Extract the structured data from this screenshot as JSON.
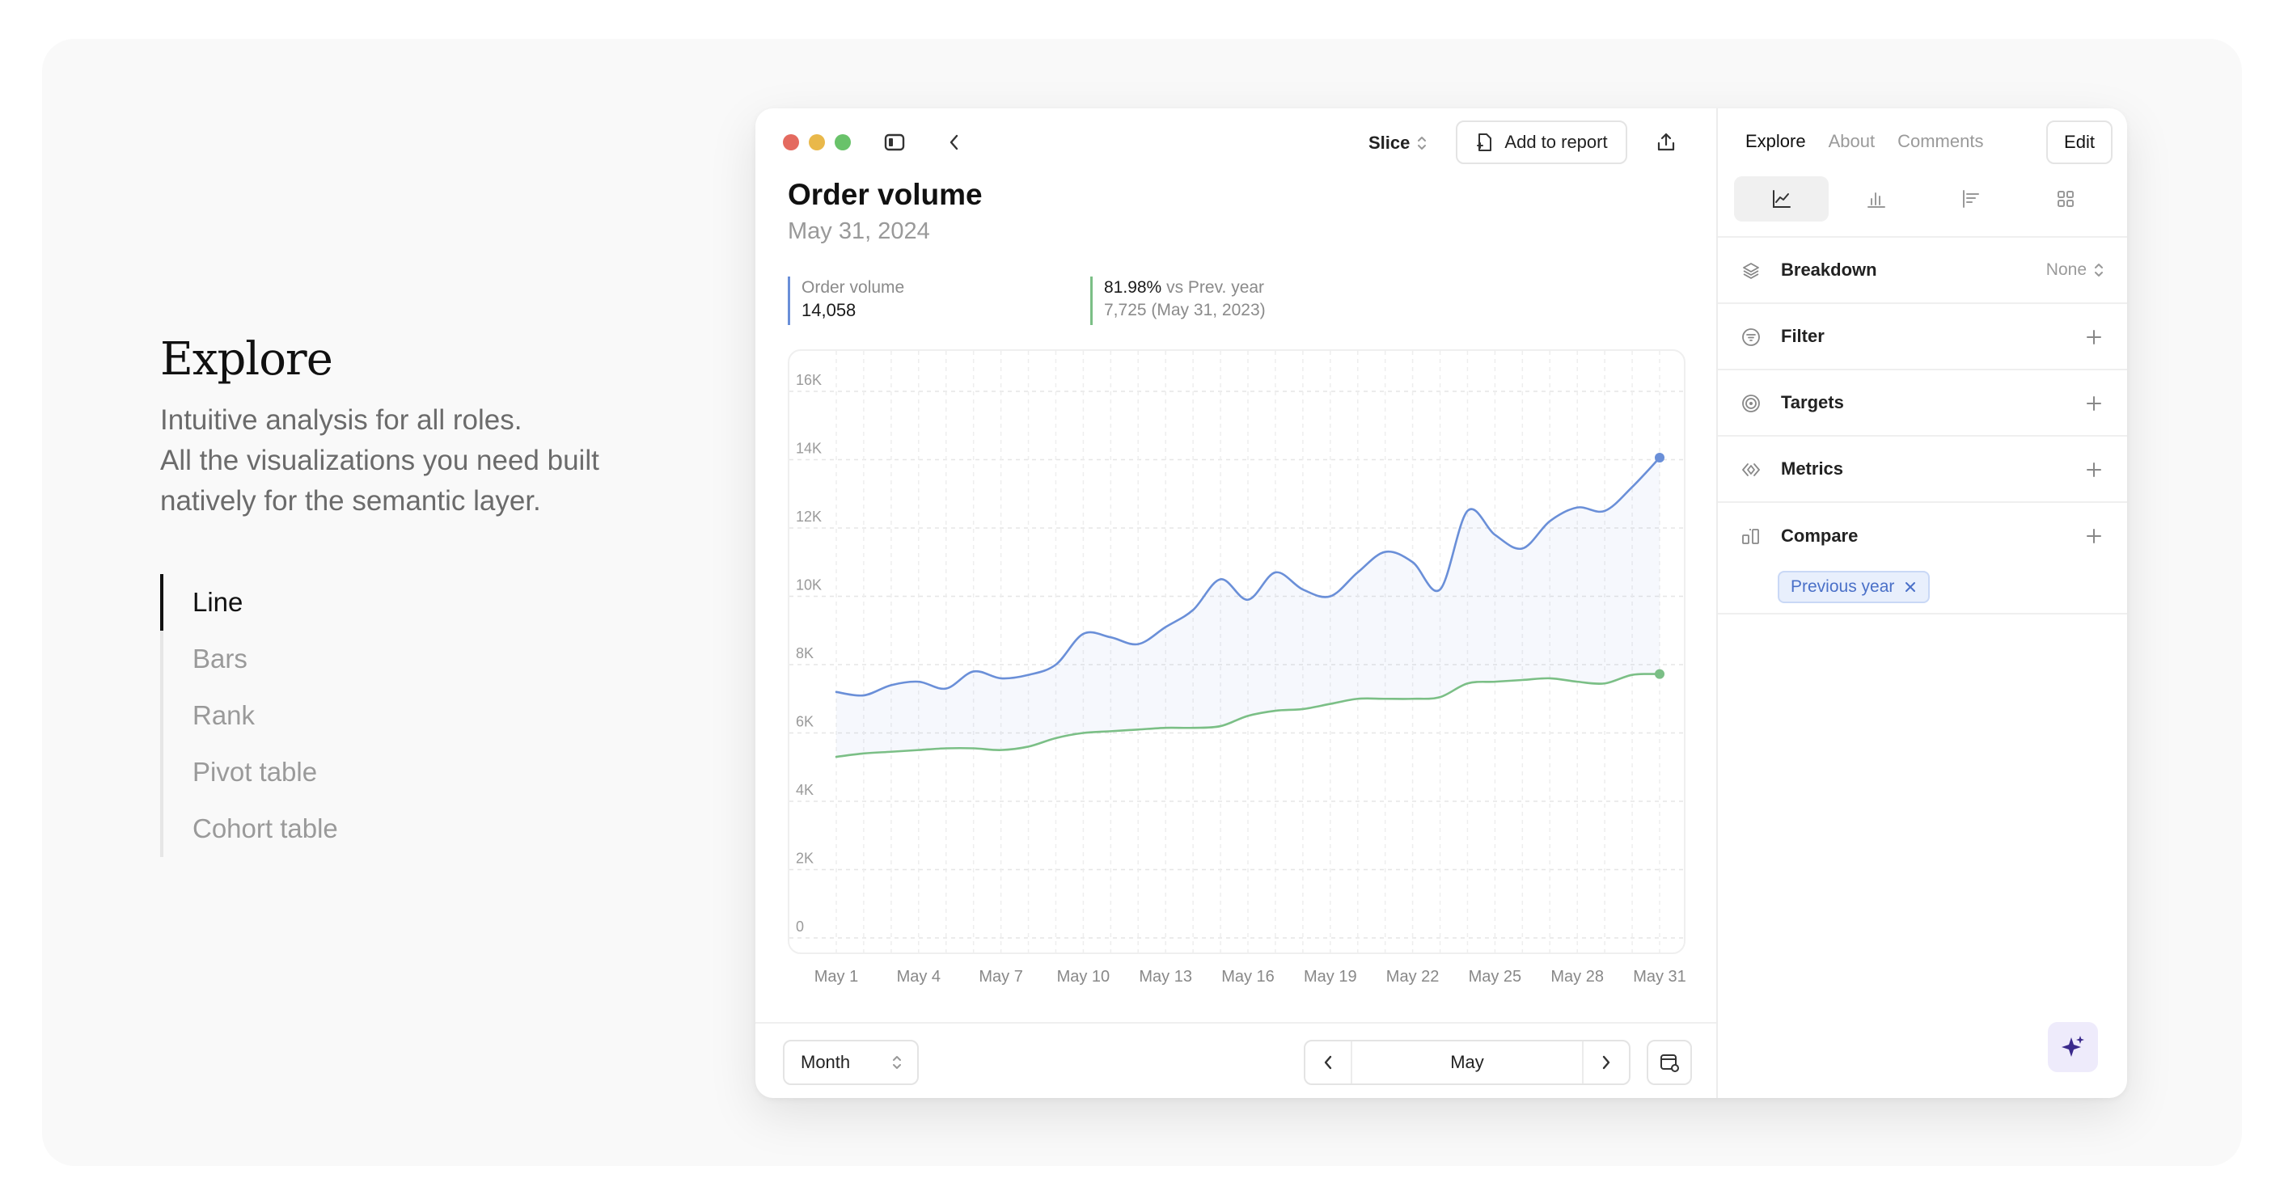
{
  "hero": {
    "title": "Explore",
    "line1": "Intuitive analysis for all roles.",
    "line2": "All the visualizations you need built",
    "line3": "natively for the semantic layer."
  },
  "modes": [
    "Line",
    "Bars",
    "Rank",
    "Pivot table",
    "Cohort table"
  ],
  "active_mode": "Line",
  "toolbar": {
    "slice_label": "Slice",
    "add_report_label": "Add to report"
  },
  "report": {
    "title": "Order volume",
    "date": "May 31, 2024"
  },
  "stats": {
    "metric_label": "Order volume",
    "metric_value": "14,058",
    "change_pct": "81.98%",
    "change_label": "vs Prev. year",
    "prev_value": "7,725 (May 31, 2023)"
  },
  "colors": {
    "current_series": "#6a8fd8",
    "previous_series": "#7bbf86",
    "window_red": "#e46a5f",
    "window_yellow": "#e9b84a",
    "window_green": "#69c26a",
    "accent_chip": "#4a70c8",
    "sparkle": "#3b2a8c"
  },
  "chart_data": {
    "type": "line",
    "x_tick_labels": [
      "May 1",
      "May 4",
      "May 7",
      "May 10",
      "May 13",
      "May 16",
      "May 19",
      "May 22",
      "May 25",
      "May 28",
      "May 31"
    ],
    "y_tick_labels": [
      "0",
      "2K",
      "4K",
      "6K",
      "8K",
      "10K",
      "12K",
      "14K",
      "16K"
    ],
    "ylim": [
      0,
      16000
    ],
    "xlim": [
      1,
      31
    ],
    "grid": true,
    "series": [
      {
        "x": [
          1,
          2,
          3,
          4,
          5,
          6,
          7,
          8,
          9,
          10,
          11,
          12,
          13,
          14,
          15,
          16,
          17,
          18,
          19,
          20,
          21,
          22,
          23,
          24,
          25,
          26,
          27,
          28,
          29,
          30,
          31
        ],
        "values": [
          7200,
          7100,
          7400,
          7500,
          7300,
          7800,
          7600,
          7700,
          8000,
          8900,
          8800,
          8600,
          9100,
          9600,
          10500,
          9900,
          10700,
          10200,
          10000,
          10700,
          11300,
          11000,
          10200,
          12500,
          11800,
          11400,
          12200,
          12600,
          12500,
          13200,
          14058
        ]
      },
      {
        "x": [
          1,
          2,
          3,
          4,
          5,
          6,
          7,
          8,
          9,
          10,
          11,
          12,
          13,
          14,
          15,
          16,
          17,
          18,
          19,
          20,
          21,
          22,
          23,
          24,
          25,
          26,
          27,
          28,
          29,
          30,
          31
        ],
        "values": [
          5300,
          5400,
          5450,
          5500,
          5550,
          5550,
          5500,
          5600,
          5850,
          6000,
          6050,
          6100,
          6150,
          6150,
          6200,
          6500,
          6650,
          6700,
          6850,
          7000,
          7000,
          7000,
          7050,
          7450,
          7500,
          7550,
          7600,
          7500,
          7450,
          7700,
          7725
        ]
      }
    ]
  },
  "bottom": {
    "granularity": "Month",
    "period": "May"
  },
  "side": {
    "tabs": [
      "Explore",
      "About",
      "Comments"
    ],
    "active_tab": "Explore",
    "edit_label": "Edit",
    "viz_icons": [
      "line-chart-icon",
      "bar-chart-icon",
      "rank-icon",
      "grid-icon"
    ],
    "sections": [
      {
        "label": "Breakdown",
        "icon": "layers-icon",
        "value": "None"
      },
      {
        "label": "Filter",
        "icon": "filter-icon"
      },
      {
        "label": "Targets",
        "icon": "target-icon"
      },
      {
        "label": "Metrics",
        "icon": "metrics-icon"
      },
      {
        "label": "Compare",
        "icon": "compare-icon"
      }
    ],
    "compare_chip": "Previous year"
  }
}
